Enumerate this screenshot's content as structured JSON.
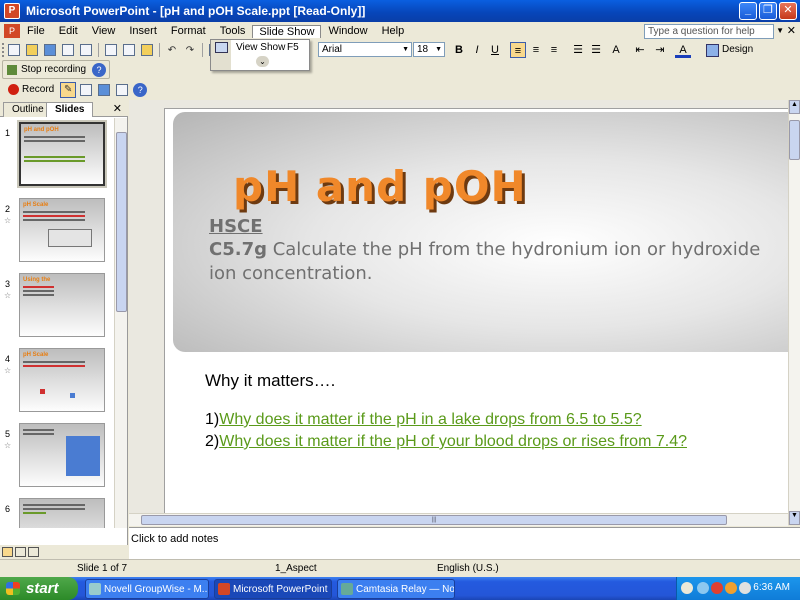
{
  "window": {
    "title": "Microsoft PowerPoint - [pH and pOH Scale.ppt [Read-Only]]",
    "minimize": "_",
    "restore": "❐",
    "close": "✕"
  },
  "menu": {
    "items": [
      "File",
      "Edit",
      "View",
      "Insert",
      "Format",
      "Tools",
      "Slide Show",
      "Window",
      "Help"
    ],
    "help_placeholder": "Type a question for help",
    "close_doc": "✕"
  },
  "slideshow_menu": {
    "item_label": "View Show",
    "item_shortcut": "F5"
  },
  "format_toolbar": {
    "font": "Arial",
    "size": "18",
    "bold": "B",
    "italic": "I",
    "underline": "U",
    "font_color": "A",
    "design": "Design"
  },
  "recording_toolbar": {
    "stop_recording": "Stop recording",
    "help": "?"
  },
  "camtasia_toolbar": {
    "record": "Record",
    "help": "?"
  },
  "left_panel": {
    "tab_outline": "Outline",
    "tab_slides": "Slides",
    "close": "✕",
    "thumbnails": [
      {
        "num": "1",
        "title": "pH and pOH"
      },
      {
        "num": "2",
        "title": "pH Scale"
      },
      {
        "num": "3",
        "title": "Using the"
      },
      {
        "num": "4",
        "title": "pH Scale"
      },
      {
        "num": "5",
        "title": ""
      },
      {
        "num": "6",
        "title": ""
      }
    ],
    "star": "☆"
  },
  "slide": {
    "title": "pH and pOH",
    "standard": "HSCE",
    "code": "C5.7g",
    "objective": " Calculate the pH from the hydronium ion or hydroxide ion concentration.",
    "why": "Why it matters….",
    "q1_num": "1)",
    "q1": "Why does it matter if the pH in a lake drops from 6.5 to 5.5?",
    "q2_num": "2)",
    "q2": "Why does it matter if the pH of your blood drops or rises from 7.4?"
  },
  "notes": {
    "placeholder": "Click to add notes"
  },
  "status": {
    "slide": "Slide 1 of 7",
    "design": "1_Aspect",
    "language": "English (U.S.)"
  },
  "taskbar": {
    "start": "start",
    "tasks": [
      "Novell GroupWise - M...",
      "Microsoft PowerPoint ...",
      "Camtasia Relay — No..."
    ],
    "clock": "6:36 AM"
  },
  "colors": {
    "title_orange": "#F0882A",
    "link_green": "#5A9A1A",
    "subtitle_gray": "#707070",
    "xp_blue": "#245ADF"
  }
}
